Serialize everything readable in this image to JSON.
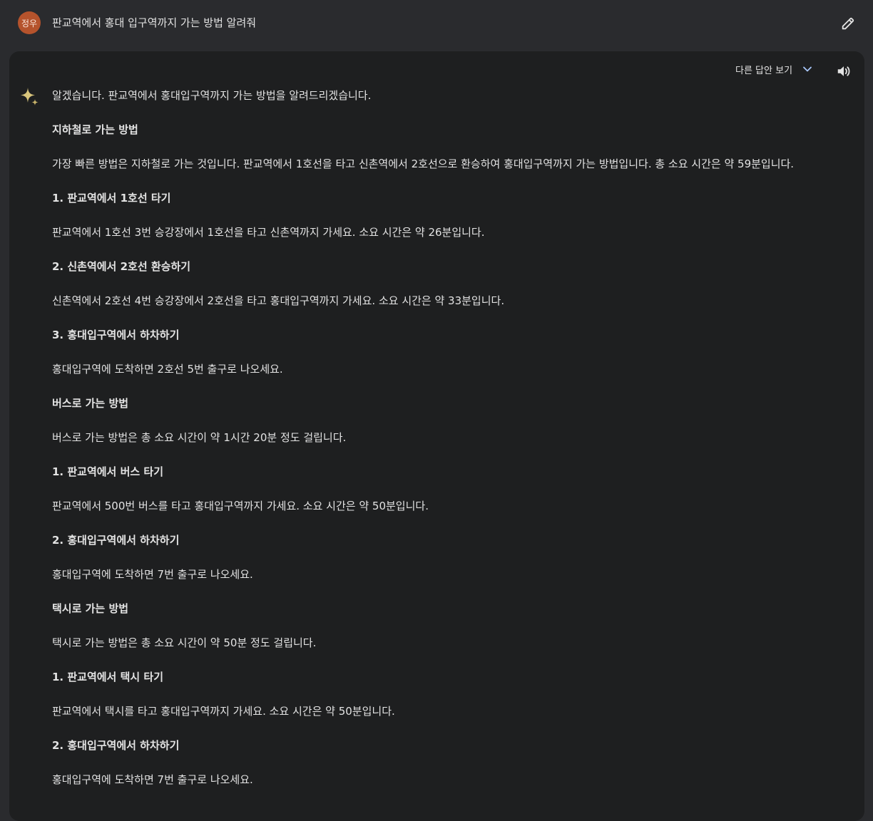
{
  "user": {
    "avatar_text": "정우",
    "avatar_color": "#b5532c"
  },
  "query": {
    "text": "판교역에서 홍대 입구역까지 가는 방법 알려줘"
  },
  "icons": {
    "edit": "pencil-icon",
    "chevron": "chevron-down-icon",
    "speaker": "speaker-icon",
    "spark": "sparkle-icon"
  },
  "response_header": {
    "drafts_label": "다른 답안 보기"
  },
  "response": {
    "paragraphs": [
      {
        "text": "알겠습니다. 판교역에서 홍대입구역까지 가는 방법을 알려드리겠습니다.",
        "bold": false
      },
      {
        "text": "지하철로 가는 방법",
        "bold": true
      },
      {
        "text": "가장 빠른 방법은 지하철로 가는 것입니다. 판교역에서 1호선을 타고 신촌역에서 2호선으로 환승하여 홍대입구역까지 가는 방법입니다. 총 소요 시간은 약 59분입니다.",
        "bold": false
      },
      {
        "text": "1. 판교역에서 1호선 타기",
        "bold": true
      },
      {
        "text": "판교역에서 1호선 3번 승강장에서 1호선을 타고 신촌역까지 가세요. 소요 시간은 약 26분입니다.",
        "bold": false
      },
      {
        "text": "2. 신촌역에서 2호선 환승하기",
        "bold": true
      },
      {
        "text": "신촌역에서 2호선 4번 승강장에서 2호선을 타고 홍대입구역까지 가세요. 소요 시간은 약 33분입니다.",
        "bold": false
      },
      {
        "text": "3. 홍대입구역에서 하차하기",
        "bold": true
      },
      {
        "text": "홍대입구역에 도착하면 2호선 5번 출구로 나오세요.",
        "bold": false
      },
      {
        "text": "버스로 가는 방법",
        "bold": true
      },
      {
        "text": "버스로 가는 방법은 총 소요 시간이 약 1시간 20분 정도 걸립니다.",
        "bold": false
      },
      {
        "text": "1. 판교역에서 버스 타기",
        "bold": true
      },
      {
        "text": "판교역에서 500번 버스를 타고 홍대입구역까지 가세요. 소요 시간은 약 50분입니다.",
        "bold": false
      },
      {
        "text": "2. 홍대입구역에서 하차하기",
        "bold": true
      },
      {
        "text": "홍대입구역에 도착하면 7번 출구로 나오세요.",
        "bold": false
      },
      {
        "text": "택시로 가는 방법",
        "bold": true
      },
      {
        "text": "택시로 가는 방법은 총 소요 시간이 약 50분 정도 걸립니다.",
        "bold": false
      },
      {
        "text": "1. 판교역에서 택시 타기",
        "bold": true
      },
      {
        "text": "판교역에서 택시를 타고 홍대입구역까지 가세요. 소요 시간은 약 50분입니다.",
        "bold": false
      },
      {
        "text": "2. 홍대입구역에서 하차하기",
        "bold": true
      },
      {
        "text": "홍대입구역에 도착하면 7번 출구로 나오세요.",
        "bold": false
      }
    ]
  },
  "colors": {
    "page_bg": "#2a2b2e",
    "card_bg": "#1e1f20",
    "text": "#e3e3e3",
    "accent_blue": "#a8c7fa",
    "spark_gold": "#d9c57c"
  }
}
